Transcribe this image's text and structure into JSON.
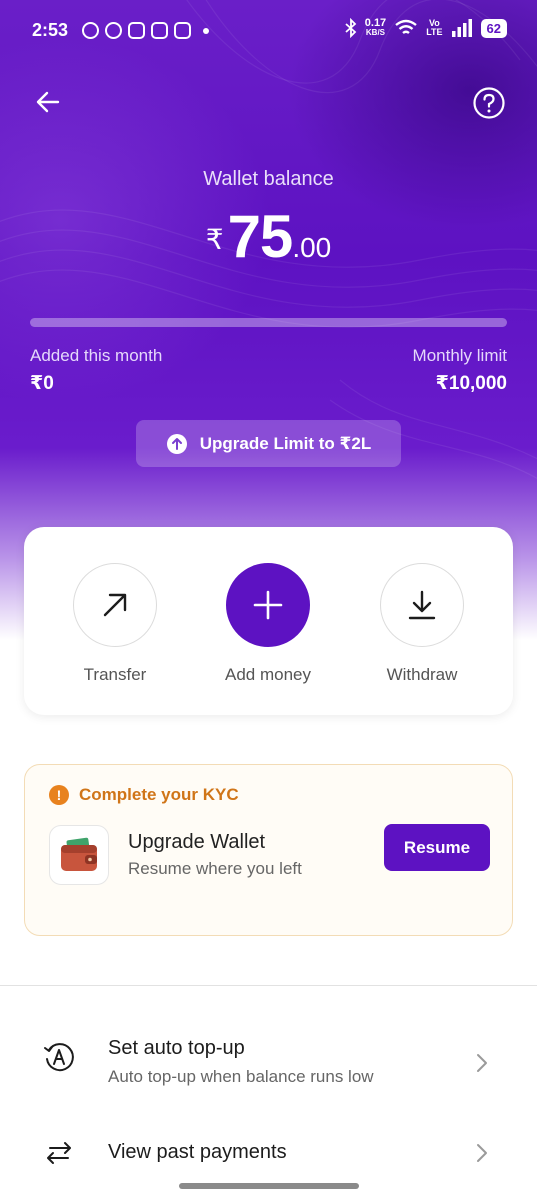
{
  "status_bar": {
    "time": "2:53",
    "speed": "0.17",
    "speed_unit": "KB/S",
    "network_top": "Vo",
    "network_bottom": "LTE",
    "battery": "62"
  },
  "header": {
    "back_icon": "arrow-left-icon",
    "help_icon": "help-circle-icon"
  },
  "wallet": {
    "label": "Wallet balance",
    "currency": "₹",
    "amount_int": "75",
    "amount_dec": ".00",
    "progress_fraction": 0,
    "added_label": "Added this month",
    "added_value": "₹0",
    "limit_label": "Monthly limit",
    "limit_value": "₹10,000",
    "upgrade_label": "Upgrade Limit to ₹2L"
  },
  "actions": [
    {
      "label": "Transfer",
      "icon": "arrow-up-right-icon"
    },
    {
      "label": "Add money",
      "icon": "plus-icon"
    },
    {
      "label": "Withdraw",
      "icon": "download-icon"
    }
  ],
  "kyc": {
    "title": "Complete your KYC",
    "heading": "Upgrade Wallet",
    "subtitle": "Resume where you left",
    "button": "Resume",
    "icon": "wallet-icon"
  },
  "options": [
    {
      "title": "Set auto top-up",
      "subtitle": "Auto top-up when balance runs low",
      "icon": "auto-topup-icon"
    },
    {
      "title": "View past payments",
      "subtitle": "",
      "icon": "swap-arrows-icon"
    }
  ],
  "colors": {
    "brand": "#5d12c2",
    "kyc_accent": "#d07518"
  }
}
